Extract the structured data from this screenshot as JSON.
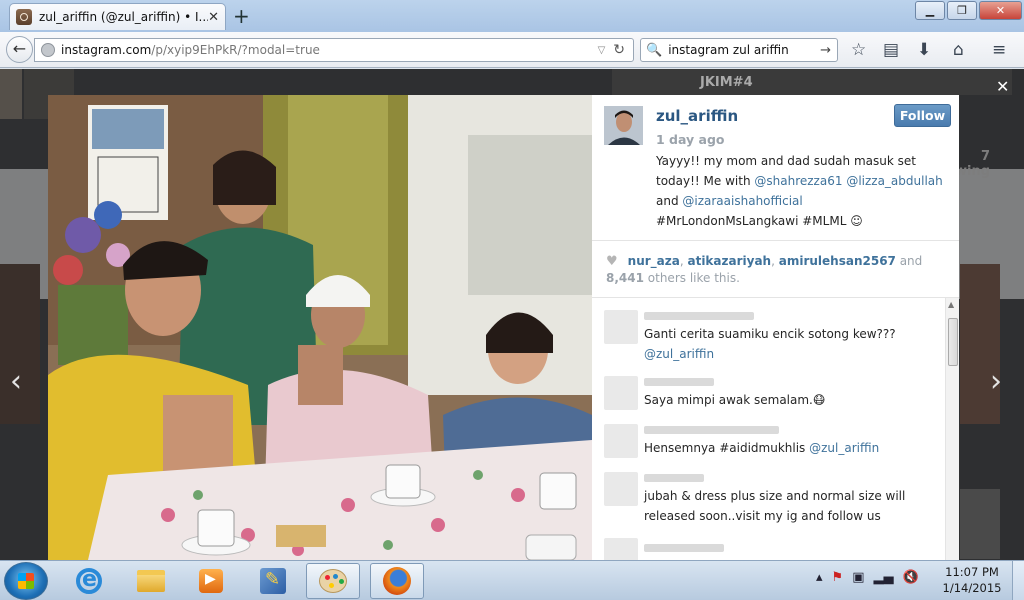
{
  "browser": {
    "tab_title": "zul_ariffin (@zul_ariffin) • I...",
    "url_host": "instagram.com",
    "url_path": "/p/xyip9EhPkR/?modal=true",
    "search_value": "instagram zul ariffin"
  },
  "background": {
    "jkim_label": "JKIM#4",
    "following_count": "7",
    "following_label": "wing"
  },
  "post": {
    "username": "zul_ariffin",
    "follow_label": "Follow",
    "time_ago": "1 day ago",
    "caption_intro": "Yayyy!! my mom and dad sudah masuk set today!! Me with ",
    "mention_1": "@shahrezza61",
    "mention_2": "@lizza_abdullah",
    "caption_and": " and ",
    "mention_3": "@izaraaishahofficial",
    "caption_tags": " #MrLondonMsLangkawi #MLML ☺",
    "likers": [
      "nur_aza",
      "atikazariyah",
      "amirulehsan2567"
    ],
    "likes_and": " and",
    "likes_count": "8,441",
    "likes_suffix": " others like this."
  },
  "comments": [
    {
      "text": "Ganti cerita suamiku encik sotong kew??? ",
      "mention": "@zul_ariffin"
    },
    {
      "text": "Saya mimpi awak semalam.😷",
      "mention": ""
    },
    {
      "text": "Hensemnya #aididmukhlis ",
      "mention": "@zul_ariffin"
    },
    {
      "text": "jubah & dress plus size and normal size will released soon..visit my ig and follow us",
      "mention": ""
    }
  ],
  "taskbar": {
    "time": "11:07 PM",
    "date": "1/14/2015"
  },
  "icons": {
    "back": "back-arrow-icon",
    "bookmark_star": "star-icon",
    "reading_list": "reading-list-icon",
    "download": "download-icon",
    "home": "home-icon",
    "menu": "menu-icon"
  },
  "colors": {
    "link_blue": "#3f729b",
    "follow_button": "#4a7bae",
    "username_blue": "#2b5782"
  }
}
